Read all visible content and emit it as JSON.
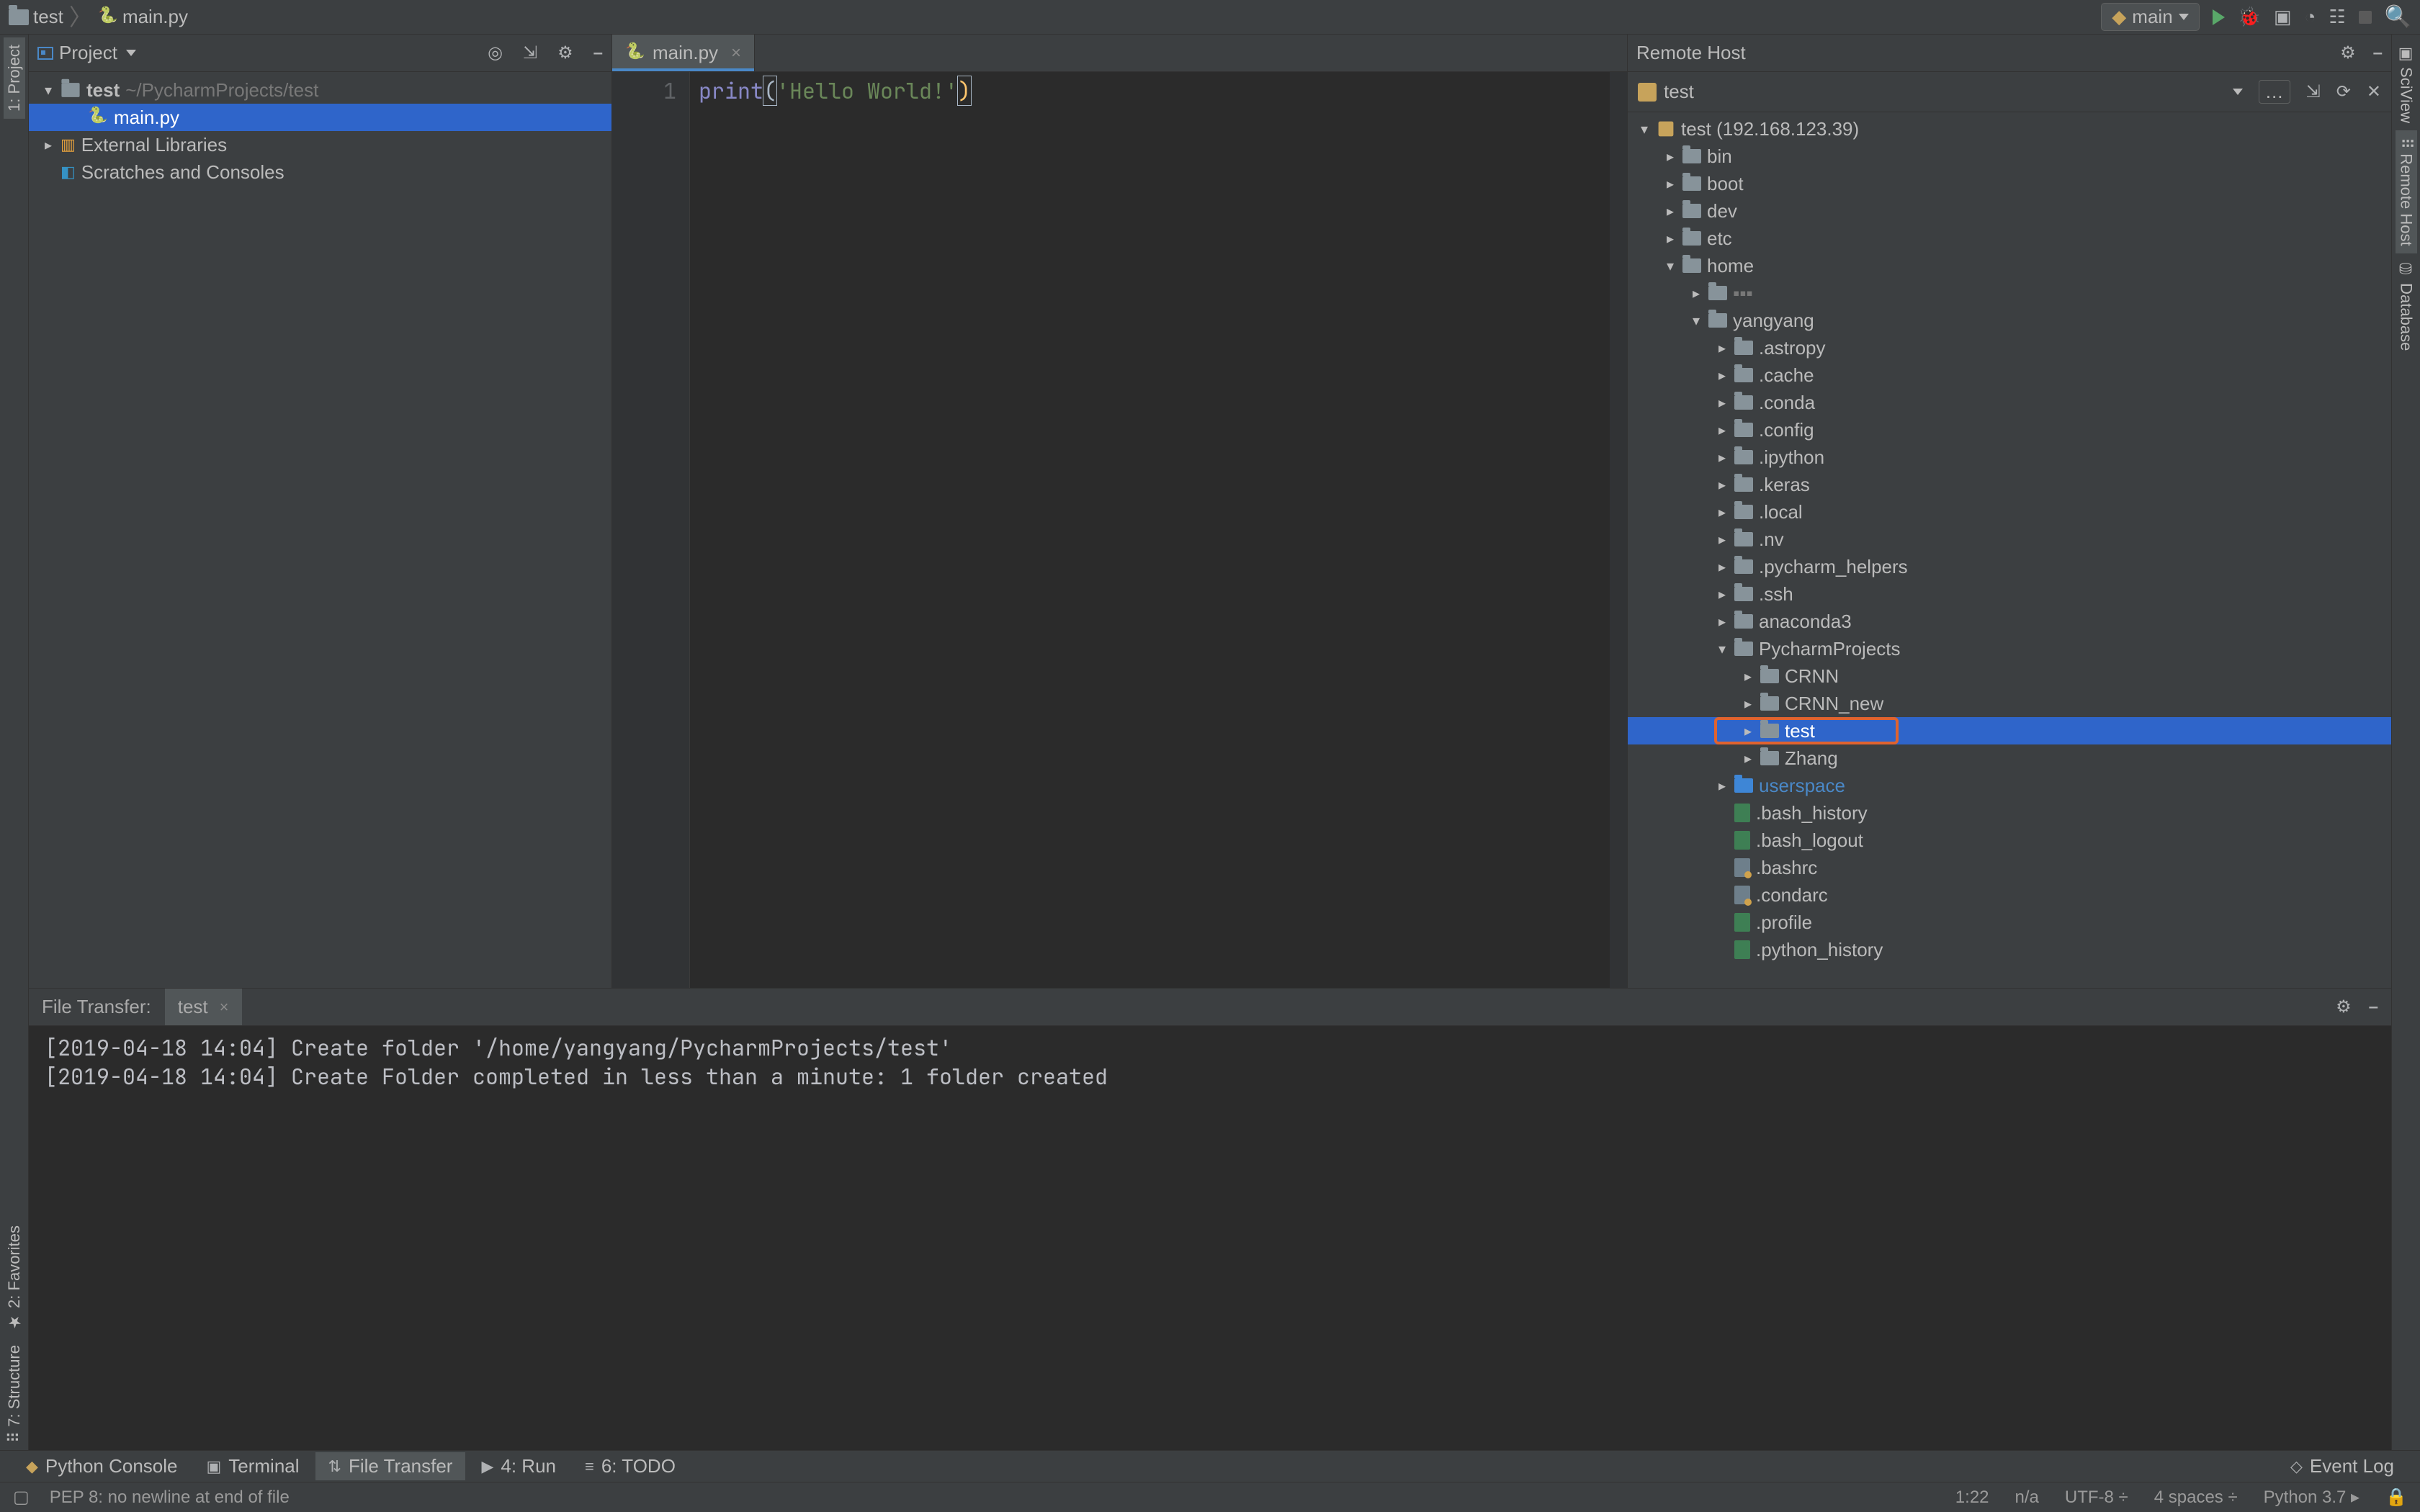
{
  "breadcrumbs": {
    "root": "test",
    "file": "main.py"
  },
  "run_config": {
    "label": "main"
  },
  "toolbar_right": {
    "search_tip": "Search Everywhere"
  },
  "project_panel": {
    "title": "Project",
    "root_name": "test",
    "root_path": "~/PycharmProjects/test",
    "file_mainpy": "main.py",
    "external_libs": "External Libraries",
    "scratches": "Scratches and Consoles"
  },
  "editor": {
    "tab_name": "main.py",
    "line_no_1": "1",
    "code_func": "print",
    "code_open_paren": "(",
    "code_str": "'Hello World!'",
    "code_close_paren": ")"
  },
  "remote_panel": {
    "title": "Remote Host",
    "server_label": "test",
    "root_label": "test (192.168.123.39)",
    "dirs_top": {
      "bin": "bin",
      "boot": "boot",
      "dev": "dev",
      "etc": "etc",
      "home": "home"
    },
    "home_unknown": "…",
    "user_yang": "yangyang",
    "yang_children": {
      "astropy": ".astropy",
      "cache": ".cache",
      "conda": ".conda",
      "config": ".config",
      "ipython": ".ipython",
      "keras": ".keras",
      "local": ".local",
      "nv": ".nv",
      "pycharm_helpers": ".pycharm_helpers",
      "ssh": ".ssh",
      "anaconda3": "anaconda3",
      "pyproj": "PycharmProjects",
      "userspace": "userspace"
    },
    "pyproj_children": {
      "crnn": "CRNN",
      "crnn_new": "CRNN_new",
      "test": "test",
      "zhang": "Zhang"
    },
    "yang_files": {
      "bash_history": ".bash_history",
      "bash_logout": ".bash_logout",
      "bashrc": ".bashrc",
      "condarc": ".condarc",
      "profile": ".profile",
      "python_history": ".python_history"
    }
  },
  "log": {
    "tab_label": "File Transfer:",
    "tab_sub": "test",
    "line1": "[2019-04-18 14:04] Create folder '/home/yangyang/PycharmProjects/test'",
    "line2": "[2019-04-18 14:04] Create Folder completed in less than a minute: 1 folder created"
  },
  "bottom_tools": {
    "python_console": "Python Console",
    "terminal": "Terminal",
    "file_transfer": "File Transfer",
    "run": "4: Run",
    "todo": "6: TODO",
    "event_log": "Event Log"
  },
  "status": {
    "pep8": "PEP 8: no newline at end of file",
    "pos": "1:22",
    "na": "n/a",
    "enc": "UTF-8",
    "indent": "4 spaces",
    "python": "Python 3.7"
  },
  "right_tabs": {
    "sciview": "SciView",
    "remote_host": "Remote Host",
    "database": "Database"
  },
  "left_tabs": {
    "project": "1: Project",
    "favorites": "2: Favorites",
    "structure": "7: Structure"
  }
}
